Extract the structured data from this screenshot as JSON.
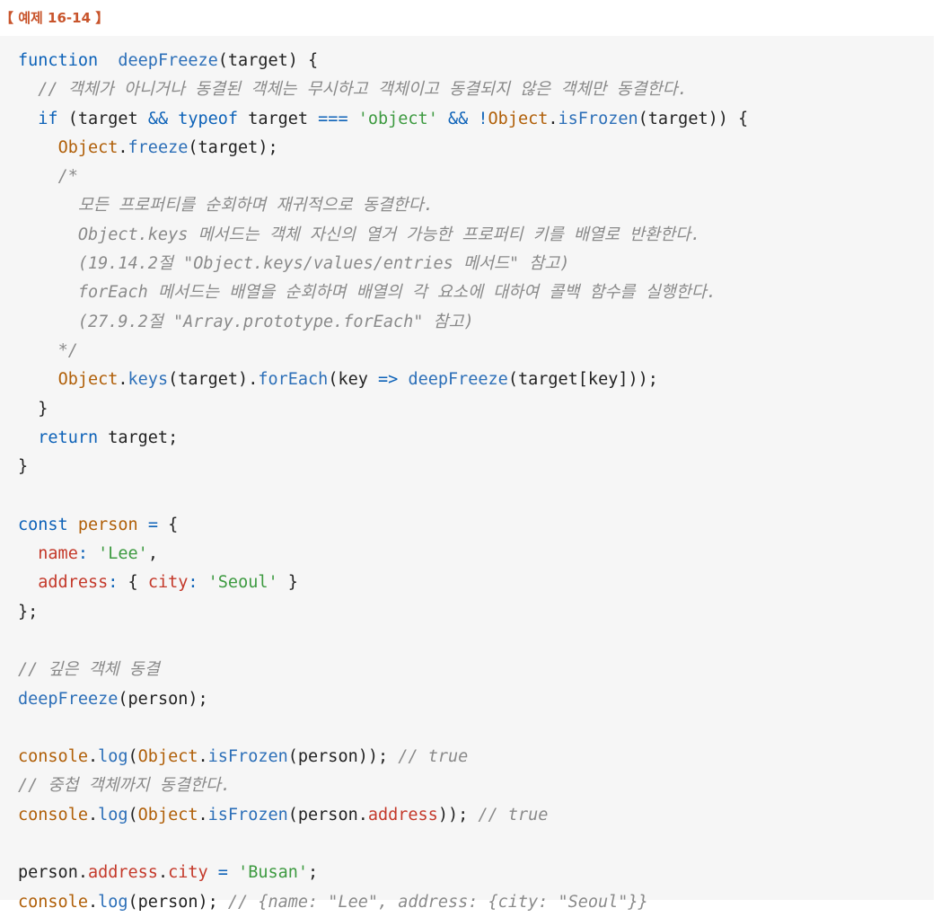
{
  "title": "【 예제 16-14 】",
  "code_lines": [
    [
      [
        "kw",
        "function"
      ],
      [
        "",
        "  "
      ],
      [
        "fn",
        "deepFreeze"
      ],
      [
        "",
        "(target) {"
      ]
    ],
    [
      [
        "",
        "  "
      ],
      [
        "cm",
        "// 객체가 아니거나 동결된 객체는 무시하고 객체이고 동결되지 않은 객체만 동결한다."
      ]
    ],
    [
      [
        "",
        "  "
      ],
      [
        "kw",
        "if"
      ],
      [
        "",
        " (target "
      ],
      [
        "op",
        "&&"
      ],
      [
        "",
        " "
      ],
      [
        "kw",
        "typeof"
      ],
      [
        "",
        " target "
      ],
      [
        "op",
        "==="
      ],
      [
        "",
        " "
      ],
      [
        "str",
        "'object'"
      ],
      [
        "",
        " "
      ],
      [
        "op",
        "&&"
      ],
      [
        "",
        " "
      ],
      [
        "op",
        "!"
      ],
      [
        "obj",
        "Object"
      ],
      [
        "",
        "."
      ],
      [
        "fn",
        "isFrozen"
      ],
      [
        "",
        "(target)) {"
      ]
    ],
    [
      [
        "",
        "    "
      ],
      [
        "obj",
        "Object"
      ],
      [
        "",
        "."
      ],
      [
        "fn",
        "freeze"
      ],
      [
        "",
        "(target);"
      ]
    ],
    [
      [
        "",
        "    "
      ],
      [
        "cm",
        "/*"
      ]
    ],
    [
      [
        "",
        "      "
      ],
      [
        "cm",
        "모든 프로퍼티를 순회하며 재귀적으로 동결한다."
      ]
    ],
    [
      [
        "",
        "      "
      ],
      [
        "cm",
        "Object.keys 메서드는 객체 자신의 열거 가능한 프로퍼티 키를 배열로 반환한다."
      ]
    ],
    [
      [
        "",
        "      "
      ],
      [
        "cm",
        "(19.14.2절 \"Object.keys/values/entries 메서드\" 참고)"
      ]
    ],
    [
      [
        "",
        "      "
      ],
      [
        "cm",
        "forEach 메서드는 배열을 순회하며 배열의 각 요소에 대하여 콜백 함수를 실행한다."
      ]
    ],
    [
      [
        "",
        "      "
      ],
      [
        "cm",
        "(27.9.2절 \"Array.prototype.forEach\" 참고)"
      ]
    ],
    [
      [
        "",
        "    "
      ],
      [
        "cm",
        "*/"
      ]
    ],
    [
      [
        "",
        "    "
      ],
      [
        "obj",
        "Object"
      ],
      [
        "",
        "."
      ],
      [
        "fn",
        "keys"
      ],
      [
        "",
        "(target)."
      ],
      [
        "fn",
        "forEach"
      ],
      [
        "",
        "(key "
      ],
      [
        "op",
        "=>"
      ],
      [
        "",
        " "
      ],
      [
        "fn",
        "deepFreeze"
      ],
      [
        "",
        "(target[key]));"
      ]
    ],
    [
      [
        "",
        "  }"
      ]
    ],
    [
      [
        "",
        "  "
      ],
      [
        "kw",
        "return"
      ],
      [
        "",
        " target;"
      ]
    ],
    [
      [
        "",
        "}"
      ]
    ],
    [],
    [
      [
        "kw",
        "const"
      ],
      [
        "",
        " "
      ],
      [
        "obj",
        "person"
      ],
      [
        "",
        " "
      ],
      [
        "op",
        "="
      ],
      [
        "",
        " {"
      ]
    ],
    [
      [
        "",
        "  "
      ],
      [
        "prop",
        "name"
      ],
      [
        "op",
        ":"
      ],
      [
        "",
        " "
      ],
      [
        "str",
        "'Lee'"
      ],
      [
        "",
        ","
      ]
    ],
    [
      [
        "",
        "  "
      ],
      [
        "prop",
        "address"
      ],
      [
        "op",
        ":"
      ],
      [
        "",
        " { "
      ],
      [
        "prop",
        "city"
      ],
      [
        "op",
        ":"
      ],
      [
        "",
        " "
      ],
      [
        "str",
        "'Seoul'"
      ],
      [
        "",
        " }"
      ]
    ],
    [
      [
        "",
        "};"
      ]
    ],
    [],
    [
      [
        "cm",
        "// 깊은 객체 동결"
      ]
    ],
    [
      [
        "fn",
        "deepFreeze"
      ],
      [
        "",
        "(person);"
      ]
    ],
    [],
    [
      [
        "obj",
        "console"
      ],
      [
        "",
        "."
      ],
      [
        "fn",
        "log"
      ],
      [
        "",
        "("
      ],
      [
        "obj",
        "Object"
      ],
      [
        "",
        "."
      ],
      [
        "fn",
        "isFrozen"
      ],
      [
        "",
        "(person)); "
      ],
      [
        "cm",
        "// true"
      ]
    ],
    [
      [
        "cm",
        "// 중첩 객체까지 동결한다."
      ]
    ],
    [
      [
        "obj",
        "console"
      ],
      [
        "",
        "."
      ],
      [
        "fn",
        "log"
      ],
      [
        "",
        "("
      ],
      [
        "obj",
        "Object"
      ],
      [
        "",
        "."
      ],
      [
        "fn",
        "isFrozen"
      ],
      [
        "",
        "(person."
      ],
      [
        "prop",
        "address"
      ],
      [
        "",
        "));"
      ],
      [
        "",
        " "
      ],
      [
        "cm",
        "// true"
      ]
    ],
    [],
    [
      [
        "",
        "person."
      ],
      [
        "prop",
        "address"
      ],
      [
        "",
        "."
      ],
      [
        "prop",
        "city"
      ],
      [
        "",
        " "
      ],
      [
        "op",
        "="
      ],
      [
        "",
        " "
      ],
      [
        "str",
        "'Busan'"
      ],
      [
        "",
        ";"
      ]
    ],
    [
      [
        "obj",
        "console"
      ],
      [
        "",
        "."
      ],
      [
        "fn",
        "log"
      ],
      [
        "",
        "(person); "
      ],
      [
        "cm",
        "// {name: \"Lee\", address: {city: \"Seoul\"}}"
      ]
    ]
  ]
}
